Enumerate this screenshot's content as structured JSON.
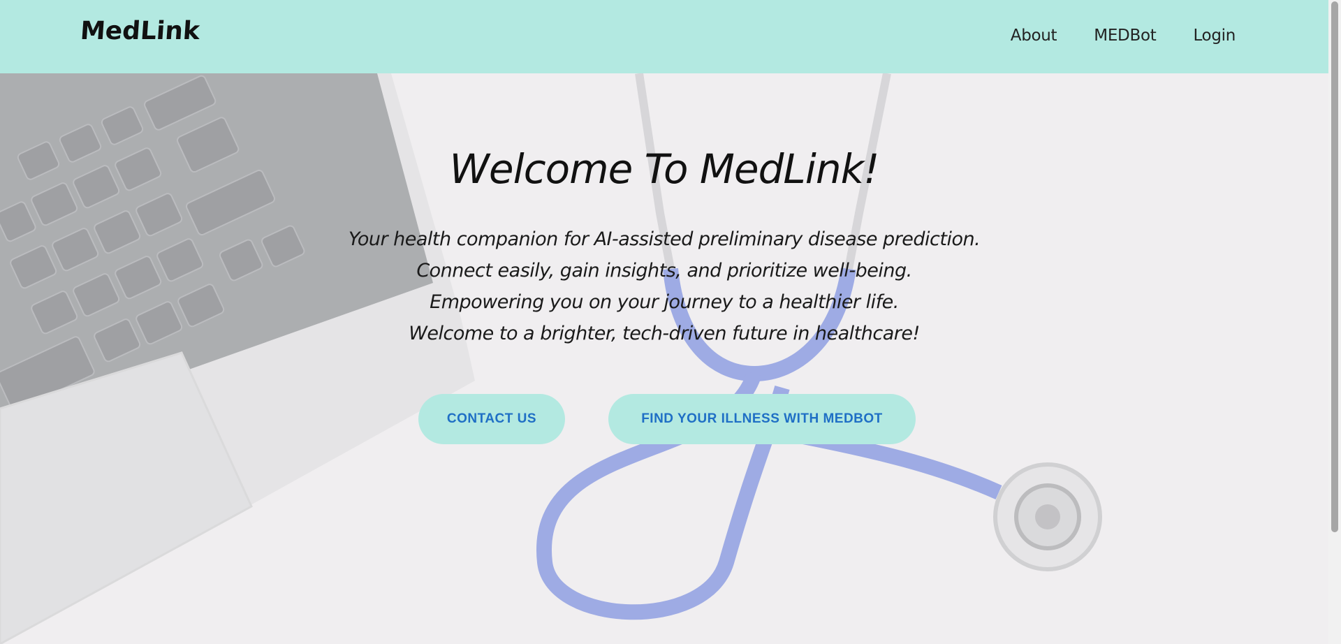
{
  "header": {
    "logo": "MedLink",
    "nav": [
      {
        "label": "About"
      },
      {
        "label": "MEDBot"
      },
      {
        "label": "Login"
      }
    ]
  },
  "hero": {
    "title": "Welcome To MedLink!",
    "tagline": [
      "Your health companion for AI-assisted preliminary disease prediction.",
      "Connect easily, gain insights, and prioritize well-being.",
      "Empowering you on your journey to a healthier life.",
      "Welcome to a brighter, tech-driven future in healthcare!"
    ],
    "buttons": {
      "contact": "CONTACT US",
      "medbot": "FIND YOUR ILLNESS WITH MEDBOT"
    }
  },
  "colors": {
    "accent": "#b3e9e1",
    "button_text": "#1f6fc5",
    "stethoscope": "#3a5bd1"
  }
}
